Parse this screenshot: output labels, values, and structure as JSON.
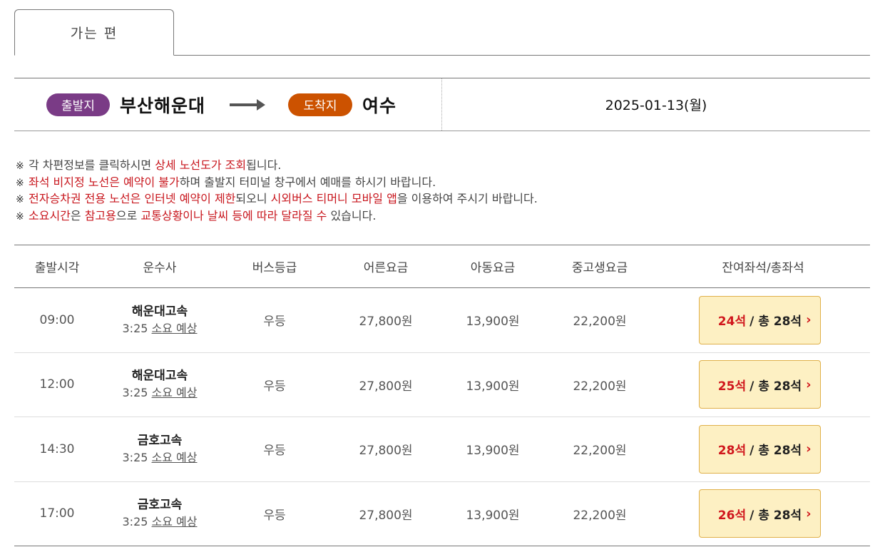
{
  "tabs": [
    {
      "label": "가는 편"
    }
  ],
  "route": {
    "departure_badge": "출발지",
    "departure": "부산해운대",
    "arrival_badge": "도착지",
    "arrival": "여수",
    "date": "2025-01-13(월)"
  },
  "notices": [
    {
      "p1": "각 차편정보를 클릭하시면 ",
      "r1": "상세 노선도가 조회",
      "p2": "됩니다.",
      "r2": "",
      "p3": ""
    },
    {
      "p1": "",
      "r1": "좌석 비지정 노선은 예약이 불가",
      "p2": "하며 출발지 터미널 창구에서 예매를 하시기 바랍니다.",
      "r2": "",
      "p3": ""
    },
    {
      "p1": "",
      "r1": "전자승차권 전용 노선은 인터넷 예약이 제한",
      "p2": "되오니 ",
      "r2": "시외버스 티머니 모바일 앱",
      "p3": "을 이용하여 주시기 바랍니다."
    },
    {
      "p1": "",
      "r1": "소요시간",
      "p2": "은 ",
      "r2": "참고용",
      "p3": "으로 ",
      "r3": "교통상황이나 날씨 등에 따라 달라질 수",
      "p4": " 있습니다."
    }
  ],
  "table": {
    "headers": [
      "출발시각",
      "운수사",
      "버스등급",
      "어른요금",
      "아동요금",
      "중고생요금",
      "잔여좌석/총좌석"
    ],
    "rows": [
      {
        "time": "09:00",
        "company": "해운대고속",
        "duration": "3:25",
        "duration_suffix": "소요 예상",
        "grade": "우등",
        "adult": "27,800원",
        "child": "13,900원",
        "teen": "22,200원",
        "remaining": "24석",
        "total": "/ 총 28석"
      },
      {
        "time": "12:00",
        "company": "해운대고속",
        "duration": "3:25",
        "duration_suffix": "소요 예상",
        "grade": "우등",
        "adult": "27,800원",
        "child": "13,900원",
        "teen": "22,200원",
        "remaining": "25석",
        "total": "/ 총 28석"
      },
      {
        "time": "14:30",
        "company": "금호고속",
        "duration": "3:25",
        "duration_suffix": "소요 예상",
        "grade": "우등",
        "adult": "27,800원",
        "child": "13,900원",
        "teen": "22,200원",
        "remaining": "28석",
        "total": "/ 총 28석"
      },
      {
        "time": "17:00",
        "company": "금호고속",
        "duration": "3:25",
        "duration_suffix": "소요 예상",
        "grade": "우등",
        "adult": "27,800원",
        "child": "13,900원",
        "teen": "22,200원",
        "remaining": "26석",
        "total": "/ 총 28석"
      }
    ]
  },
  "notice_mark": "※",
  "colors": {
    "departure": "#7a3b86",
    "arrival": "#cc5200",
    "highlight": "#c8161d",
    "seat_bg": "#fdf0c3"
  }
}
